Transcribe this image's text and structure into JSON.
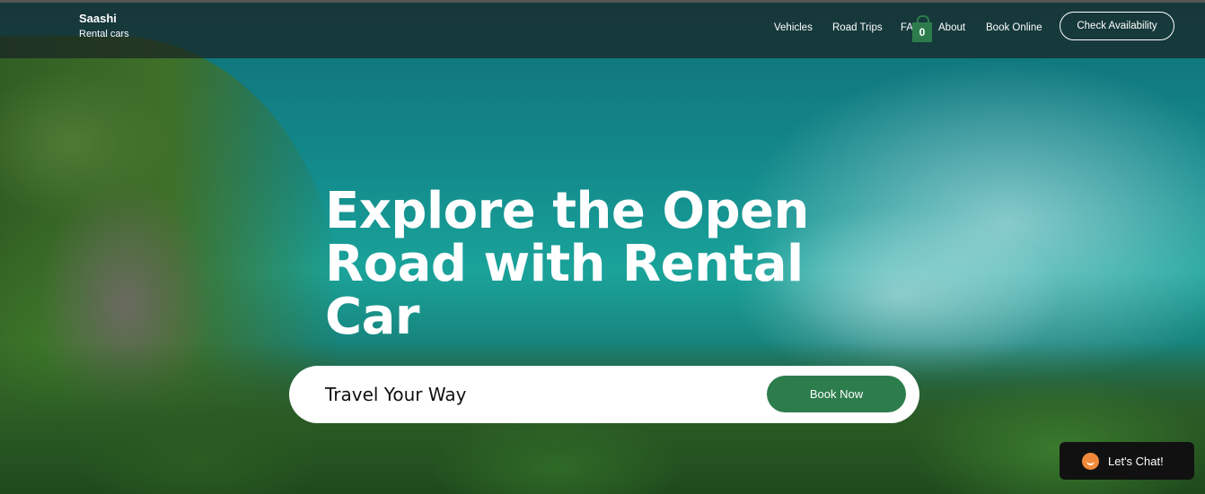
{
  "brand": {
    "name": "Saashi",
    "tagline": "Rental cars"
  },
  "nav": {
    "items": [
      "Vehicles",
      "Road Trips",
      "FAQ",
      "About",
      "Book Online"
    ],
    "cart_count": "0",
    "cta_label": "Check Availability"
  },
  "hero": {
    "headline": "Explore the Open Road with Rental Car",
    "search_text": "Travel Your Way",
    "book_label": "Book Now"
  },
  "chat": {
    "label": "Let's Chat!"
  },
  "colors": {
    "accent": "#2d7d4c",
    "chat_bg": "#111111",
    "chat_icon": "#f08a3a"
  }
}
